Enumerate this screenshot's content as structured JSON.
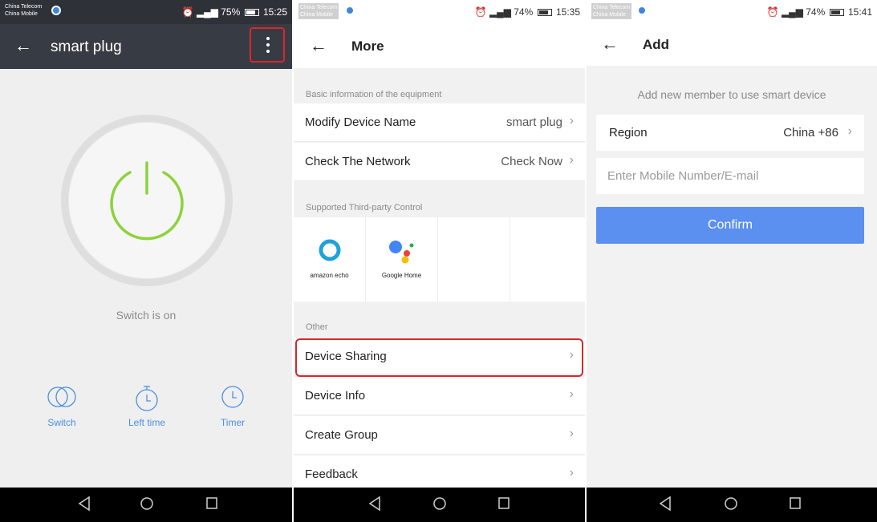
{
  "status": {
    "carrier1": "China Telecom",
    "carrier2": "China Mobile",
    "screen1": {
      "battery": "75%",
      "time": "15:25"
    },
    "screen2": {
      "battery": "74%",
      "time": "15:35"
    },
    "screen3": {
      "battery": "74%",
      "time": "15:41"
    }
  },
  "screen1": {
    "title": "smart plug",
    "status_text": "Switch is on",
    "controls": [
      {
        "label": "Switch",
        "icon": "switch-icon"
      },
      {
        "label": "Left time",
        "icon": "stopwatch-icon"
      },
      {
        "label": "Timer",
        "icon": "clock-icon"
      }
    ],
    "colors": {
      "header": "#373c44",
      "power": "#8cd33a",
      "accent": "#4a90e2"
    }
  },
  "screen2": {
    "title": "More",
    "section_basic": "Basic information of the equipment",
    "modify_name": {
      "label": "Modify Device Name",
      "value": "smart plug"
    },
    "check_network": {
      "label": "Check The Network",
      "value": "Check Now"
    },
    "section_third_party": "Supported Third-party Control",
    "third_party": [
      {
        "name": "amazon echo",
        "icon": "amazon-echo-icon"
      },
      {
        "name": "Google Home",
        "icon": "google-assistant-icon"
      }
    ],
    "section_other": "Other",
    "other_items": [
      "Device Sharing",
      "Device Info",
      "Create Group",
      "Feedback"
    ]
  },
  "screen3": {
    "title": "Add",
    "hint": "Add new member to use smart device",
    "region": {
      "label": "Region",
      "value": "China +86"
    },
    "account_placeholder": "Enter Mobile Number/E-mail",
    "confirm_label": "Confirm",
    "colors": {
      "confirm": "#5b8ff0"
    }
  }
}
